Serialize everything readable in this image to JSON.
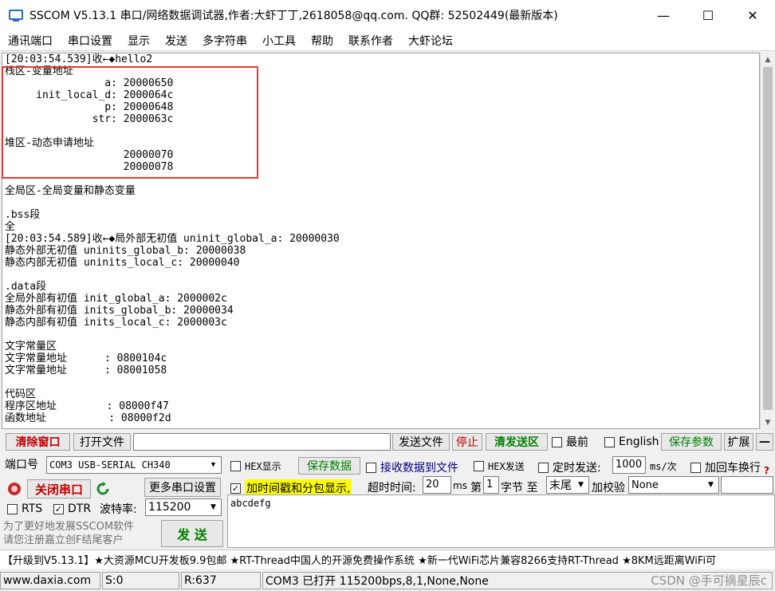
{
  "window": {
    "title": "SSCOM V5.13.1 串口/网络数据调试器,作者:大虾丁丁,2618058@qq.com. QQ群: 52502449(最新版本)",
    "minimize": "—",
    "maximize": "☐",
    "close": "✕"
  },
  "menu": [
    "通讯端口",
    "串口设置",
    "显示",
    "发送",
    "多字符串",
    "小工具",
    "帮助",
    "联系作者",
    "大虾论坛"
  ],
  "receive": {
    "lines": [
      "[20:03:54.539]收←◆hello2",
      "栈区-变量地址",
      "                a: 20000650",
      "     init_local_d: 2000064c",
      "                p: 20000648",
      "              str: 2000063c",
      "",
      "堆区-动态申请地址",
      "                   20000070",
      "                   20000078",
      "",
      "全局区-全局变量和静态变量",
      "",
      ".bss段",
      "全",
      "[20:03:54.589]收←◆局外部无初值 uninit_global_a: 20000030",
      "静态外部无初值 uninits_global_b: 20000038",
      "静态内部无初值 uninits_local_c: 20000040",
      "",
      ".data段",
      "全局外部有初值 init_global_a: 2000002c",
      "静态外部有初值 inits_global_b: 20000034",
      "静态内部有初值 inits_local_c: 2000003c",
      "",
      "文字常量区",
      "文字常量地址      : 0800104c",
      "文字常量地址      : 08001058",
      "",
      "代码区",
      "程序区地址        : 08000f47",
      "函数地址          : 08000f2d"
    ]
  },
  "toolbar": {
    "clear": "清除窗口",
    "open_file": "打开文件",
    "file_path": "",
    "send_file": "发送文件",
    "stop": "停止",
    "clear_send": "清发送区",
    "topmost": "最前",
    "english": "English",
    "save_params": "保存参数",
    "expand": "扩展",
    "collapse": "—"
  },
  "port": {
    "label": "端口号",
    "value": "COM3 USB-SERIAL CH340",
    "close_port": "关闭串口",
    "more_settings": "更多串口设置",
    "rts": "RTS",
    "dtr": "DTR",
    "baud_label": "波特率:",
    "baud_value": "115200",
    "promo1": "为了更好地发展SSCOM软件",
    "promo2": "请您注册嘉立创F结尾客户",
    "send": "发 送"
  },
  "options": {
    "hex_display": "HEX显示",
    "save_data": "保存数据",
    "recv_to_file": "接收数据到文件",
    "hex_send": "HEX发送",
    "timed_send": "定时发送:",
    "interval": "1000",
    "interval_unit": "ms/次",
    "add_crlf": "加回车换行",
    "timestamp": "加时间戳和分包显示,",
    "timeout_label": "超时时间:",
    "timeout": "20",
    "timeout_unit": "ms",
    "byte_label_pre": "第",
    "byte_index": "1",
    "byte_label_post": "字节 至",
    "byte_end": "末尾",
    "checksum_label": "加校验",
    "checksum": "None"
  },
  "send_text": "abcdefg",
  "ticker": "【升级到V5.13.1】★大资源MCU开发板9.9包邮 ★RT-Thread中国人的开源免费操作系统 ★新一代WiFi芯片兼容8266支持RT-Thread ★8KM远距离WiFi可",
  "status": {
    "site": "www.daxia.com",
    "sent": "S:0",
    "received": "R:637",
    "port_state": "COM3 已打开  115200bps,8,1,None,None"
  },
  "watermark": "CSDN @手可摘星辰c",
  "colors": {
    "highlight_box": "#e53935",
    "timestamp_bg": "#ffff00",
    "accent_green": "#008000",
    "accent_red": "#c00000"
  }
}
